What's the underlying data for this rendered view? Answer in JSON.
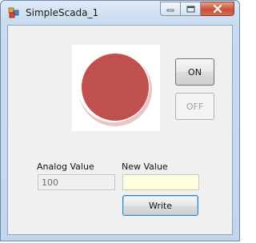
{
  "window": {
    "title": "SimpleScada_1"
  },
  "lamp": {
    "state": "off",
    "color": "#c0504d"
  },
  "buttons": {
    "on_label": "ON",
    "off_label": "OFF",
    "write_label": "Write"
  },
  "analog": {
    "label": "Analog Value",
    "value": "100"
  },
  "new_value": {
    "label": "New Value",
    "value": ""
  },
  "icons": {
    "app": "app-icon",
    "minimize": "minimize-icon",
    "maximize": "maximize-icon",
    "close": "close-icon"
  }
}
